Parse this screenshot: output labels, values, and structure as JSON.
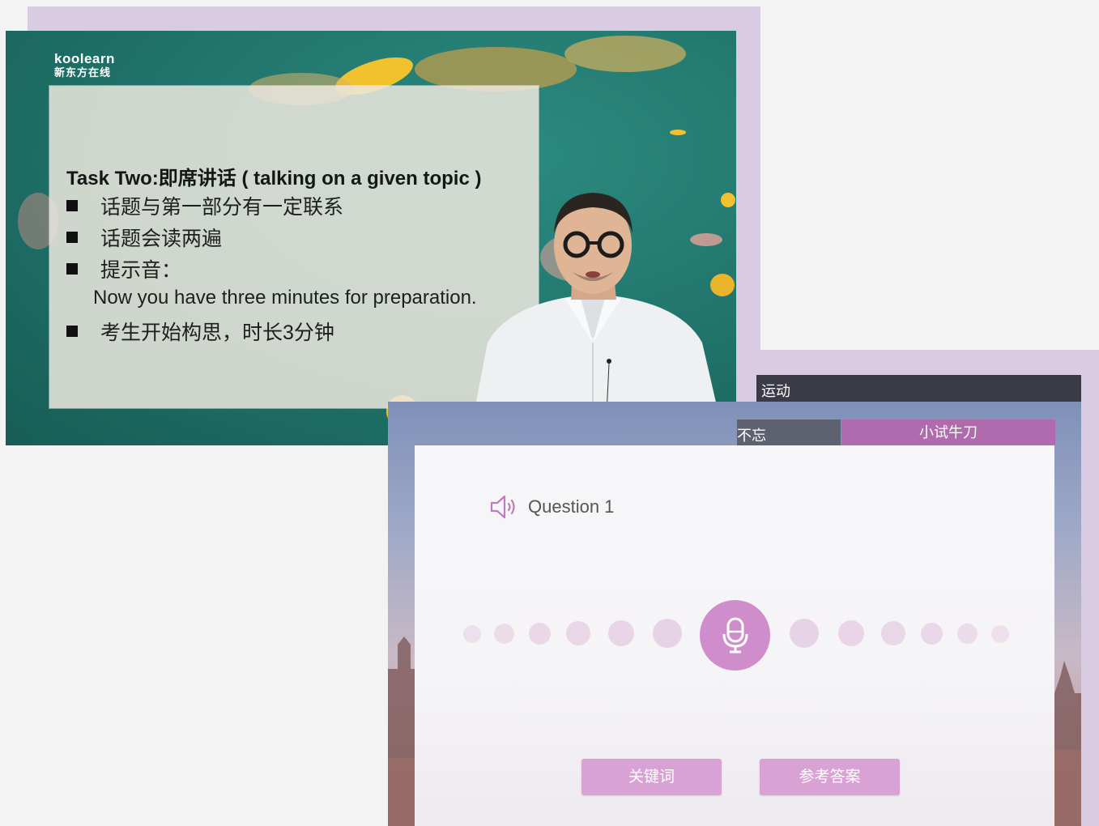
{
  "lecture": {
    "logo": {
      "brand": "koolearn",
      "brand_cn": "新东方在线"
    },
    "slide": {
      "title": "Task Two:即席讲话 ( talking on a given topic )",
      "bullets": [
        "话题与第一部分有一定联系",
        "话题会读两遍",
        "提示音："
      ],
      "prompt_line": "Now you have three minutes for preparation.",
      "last_bullet": "考生开始构思，时长3分钟"
    }
  },
  "app": {
    "topbar_text": "运动",
    "tabs": {
      "left_label": "不忘",
      "active_label": "小试牛刀"
    },
    "question_label": "Question 1",
    "buttons": {
      "keywords": "关键词",
      "reference_answer": "参考答案"
    }
  },
  "colors": {
    "accent": "#cf8ecb",
    "tab_active": "#b06aae",
    "button": "#d8a2d4",
    "frame": "#d9cce2",
    "video_bg": "#1f7269"
  }
}
